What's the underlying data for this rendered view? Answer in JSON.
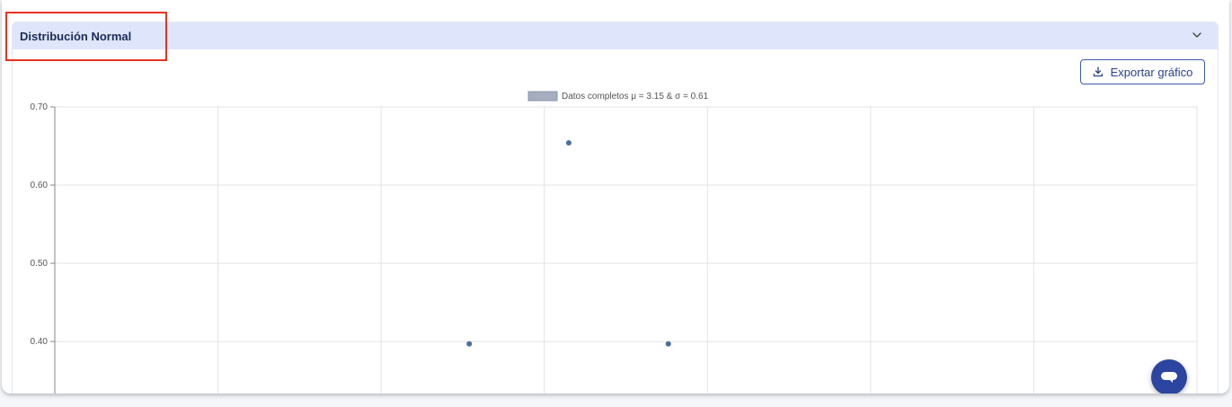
{
  "section": {
    "title": "Distribución Normal",
    "export_label": "Exportar gráfico"
  },
  "icons": {
    "collapse": "chevron-down-icon",
    "export": "download-icon",
    "chat": "chat-icon"
  },
  "colors": {
    "header_bg": "#dfe6fb",
    "accent": "#2c45a0",
    "point": "#4a6fa5",
    "highlight": "#e8321f"
  },
  "chart_data": {
    "type": "scatter",
    "legend": {
      "label": "Datos completos μ = 3.15 & σ = 0.61",
      "position": "top-center"
    },
    "series": [
      {
        "name": "Datos completos μ = 3.15 & σ = 0.61",
        "points": [
          {
            "x": 2.54,
            "y": 0.397
          },
          {
            "x": 3.15,
            "y": 0.654
          },
          {
            "x": 3.76,
            "y": 0.397
          }
        ]
      }
    ],
    "xlim": [
      0,
      7
    ],
    "ylim": [
      0.33,
      0.7
    ],
    "yticks": [
      "0.70",
      "0.60",
      "0.50",
      "0.40"
    ],
    "grid": true
  }
}
